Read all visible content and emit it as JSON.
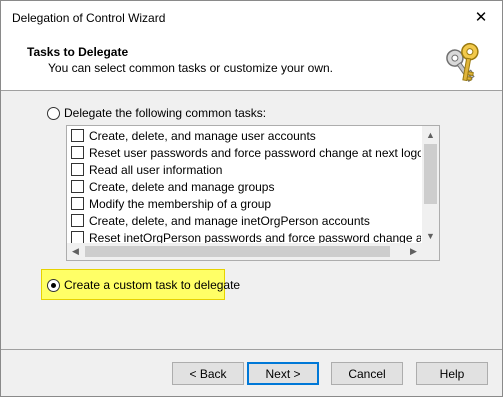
{
  "window": {
    "title": "Delegation of Control Wizard"
  },
  "header": {
    "title": "Tasks to Delegate",
    "subtitle": "You can select common tasks or customize your own.",
    "icon": "keys-icon"
  },
  "options": {
    "common": {
      "label": "Delegate the following common tasks:",
      "selected": false
    },
    "custom": {
      "label": "Create a custom task to delegate",
      "selected": true
    }
  },
  "tasks": [
    {
      "label": "Create, delete, and manage user accounts",
      "checked": false
    },
    {
      "label": "Reset user passwords and force password change at next logon",
      "checked": false
    },
    {
      "label": "Read all user information",
      "checked": false
    },
    {
      "label": "Create, delete and manage groups",
      "checked": false
    },
    {
      "label": "Modify the membership of a group",
      "checked": false
    },
    {
      "label": "Create, delete, and manage inetOrgPerson accounts",
      "checked": false
    },
    {
      "label": "Reset inetOrgPerson passwords and force password change at next lo",
      "checked": false
    }
  ],
  "buttons": {
    "back": "< Back",
    "next": "Next >",
    "cancel": "Cancel",
    "help": "Help"
  },
  "colors": {
    "highlight": "#ffff66",
    "default_button_border": "#0078d7"
  }
}
